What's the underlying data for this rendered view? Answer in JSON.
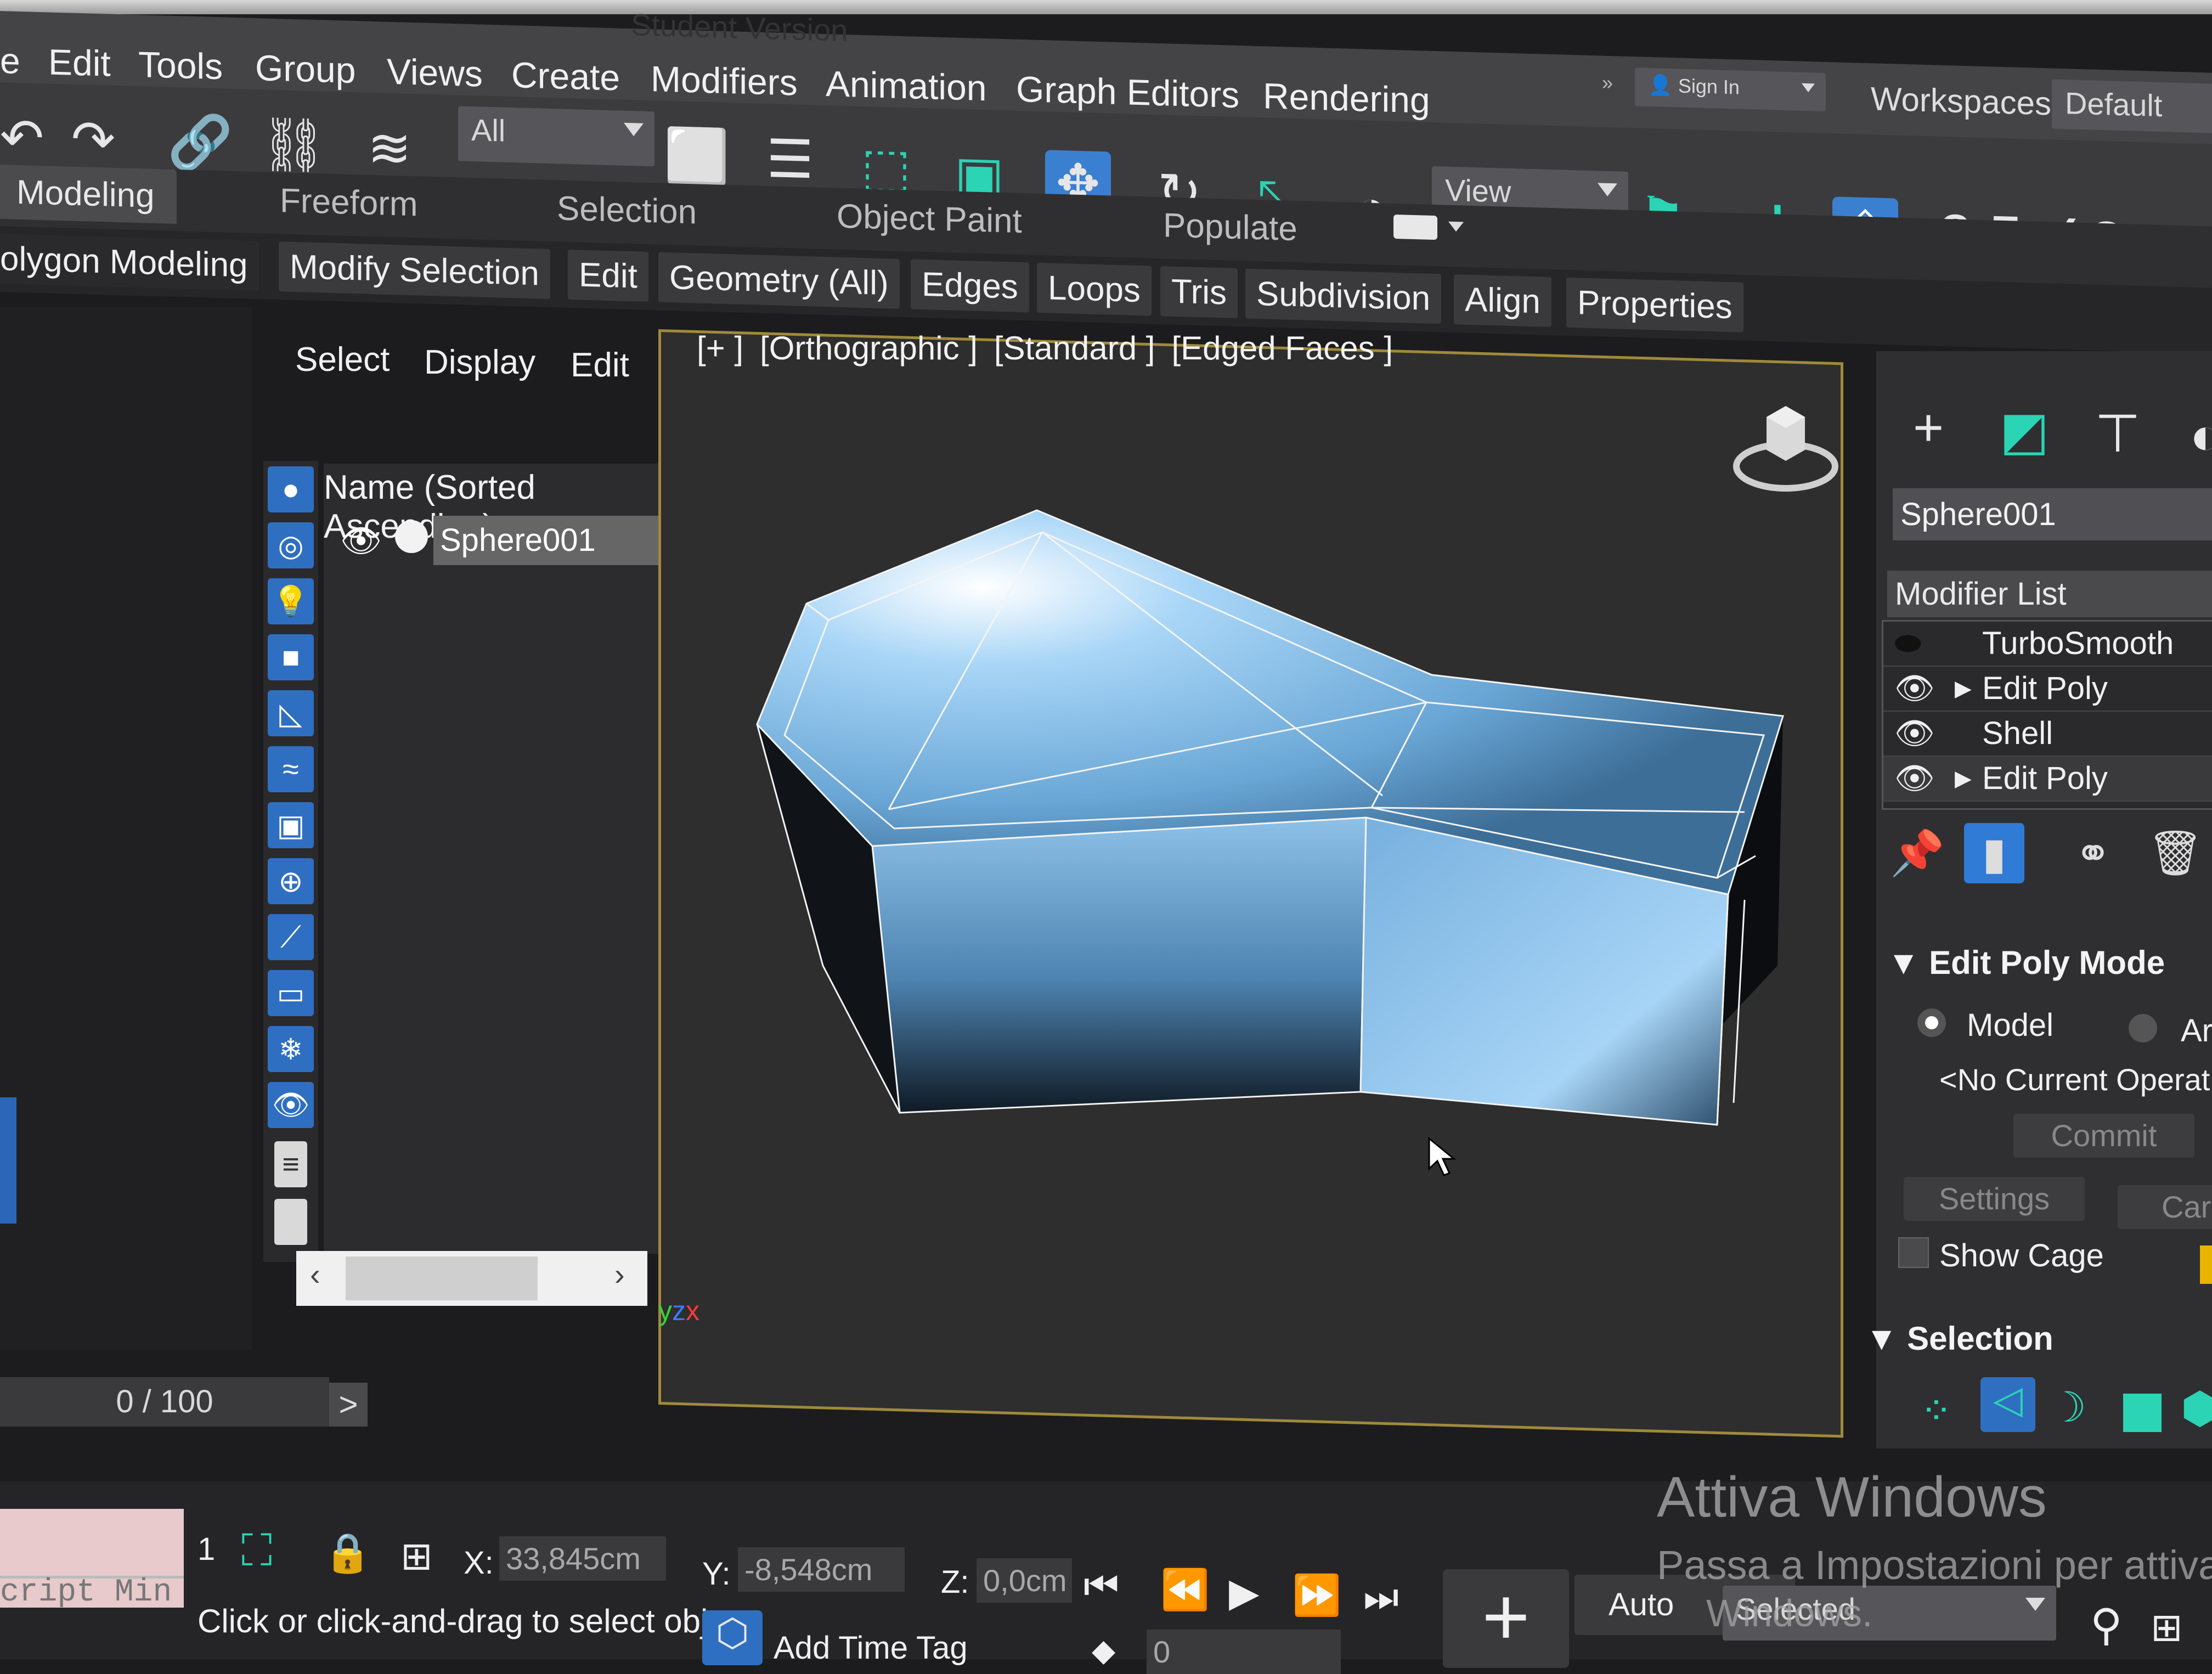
{
  "window": {
    "title_fragment": "Student Version"
  },
  "menu": [
    "Edit",
    "Tools",
    "Group",
    "Views",
    "Create",
    "Modifiers",
    "Animation",
    "Graph Editors",
    "Rendering"
  ],
  "menu_first_fragment": "e",
  "toolbar": {
    "selection_filter": "All",
    "ref_coord": "View",
    "sign_in": "Sign In",
    "workspaces_label": "Workspaces:",
    "workspace_value": "Default",
    "snap_labels": [
      "2.5",
      "?",
      "%"
    ]
  },
  "ribbon": {
    "tabs": [
      "Modeling",
      "Freeform",
      "Selection",
      "Object Paint",
      "Populate"
    ],
    "active_tab": "Modeling",
    "sub_panel_fragment": "olygon Modeling",
    "sub_tabs": [
      "Modify Selection",
      "Edit",
      "Geometry (All)",
      "Edges",
      "Loops",
      "Tris",
      "Subdivision",
      "Align",
      "Properties"
    ]
  },
  "explorer": {
    "menus": [
      "Select",
      "Display",
      "Edit"
    ],
    "column_header": "Name (Sorted Ascending)",
    "rows": [
      {
        "name": "Sphere001"
      }
    ],
    "progress": "0 / 100"
  },
  "viewport": {
    "labels": [
      "[+ ]",
      "[Orthographic ]",
      "[Standard ]",
      "[Edged Faces ]"
    ],
    "object_color": "#8ec2ea"
  },
  "command_panel": {
    "object_name": "Sphere001",
    "modifier_list": "Modifier List",
    "stack": [
      {
        "name": "TurboSmooth",
        "eye": false,
        "expand": false
      },
      {
        "name": "Edit Poly",
        "eye": true,
        "expand": true
      },
      {
        "name": "Shell",
        "eye": true,
        "expand": false
      },
      {
        "name": "Edit Poly",
        "eye": true,
        "expand": true
      }
    ],
    "edit_poly_mode": {
      "title": "Edit Poly Mode",
      "model_label": "Model",
      "animate_fragment": "Ar",
      "no_op": "<No Current Operat",
      "commit": "Commit",
      "settings": "Settings",
      "cancel_fragment": "Car",
      "show_cage": "Show Cage"
    },
    "selection_title": "Selection"
  },
  "statusbar": {
    "maxscript": "cript Min",
    "selected_count": "1",
    "status_text": "Click or click-and-drag to select objec",
    "x_label": "X:",
    "x_value": "33,845cm",
    "y_label": "Y:",
    "y_value": "-8,548cm",
    "z_label": "Z:",
    "z_value": "0,0cm",
    "add_time_tag": "Add Time Tag",
    "frame_value": "0",
    "auto_key": "Auto",
    "selected_dropdown": "Selected"
  },
  "watermark": {
    "line1": "Attiva Windows",
    "line2": "Passa a Impostazioni per attiva",
    "line3": "Windows."
  }
}
